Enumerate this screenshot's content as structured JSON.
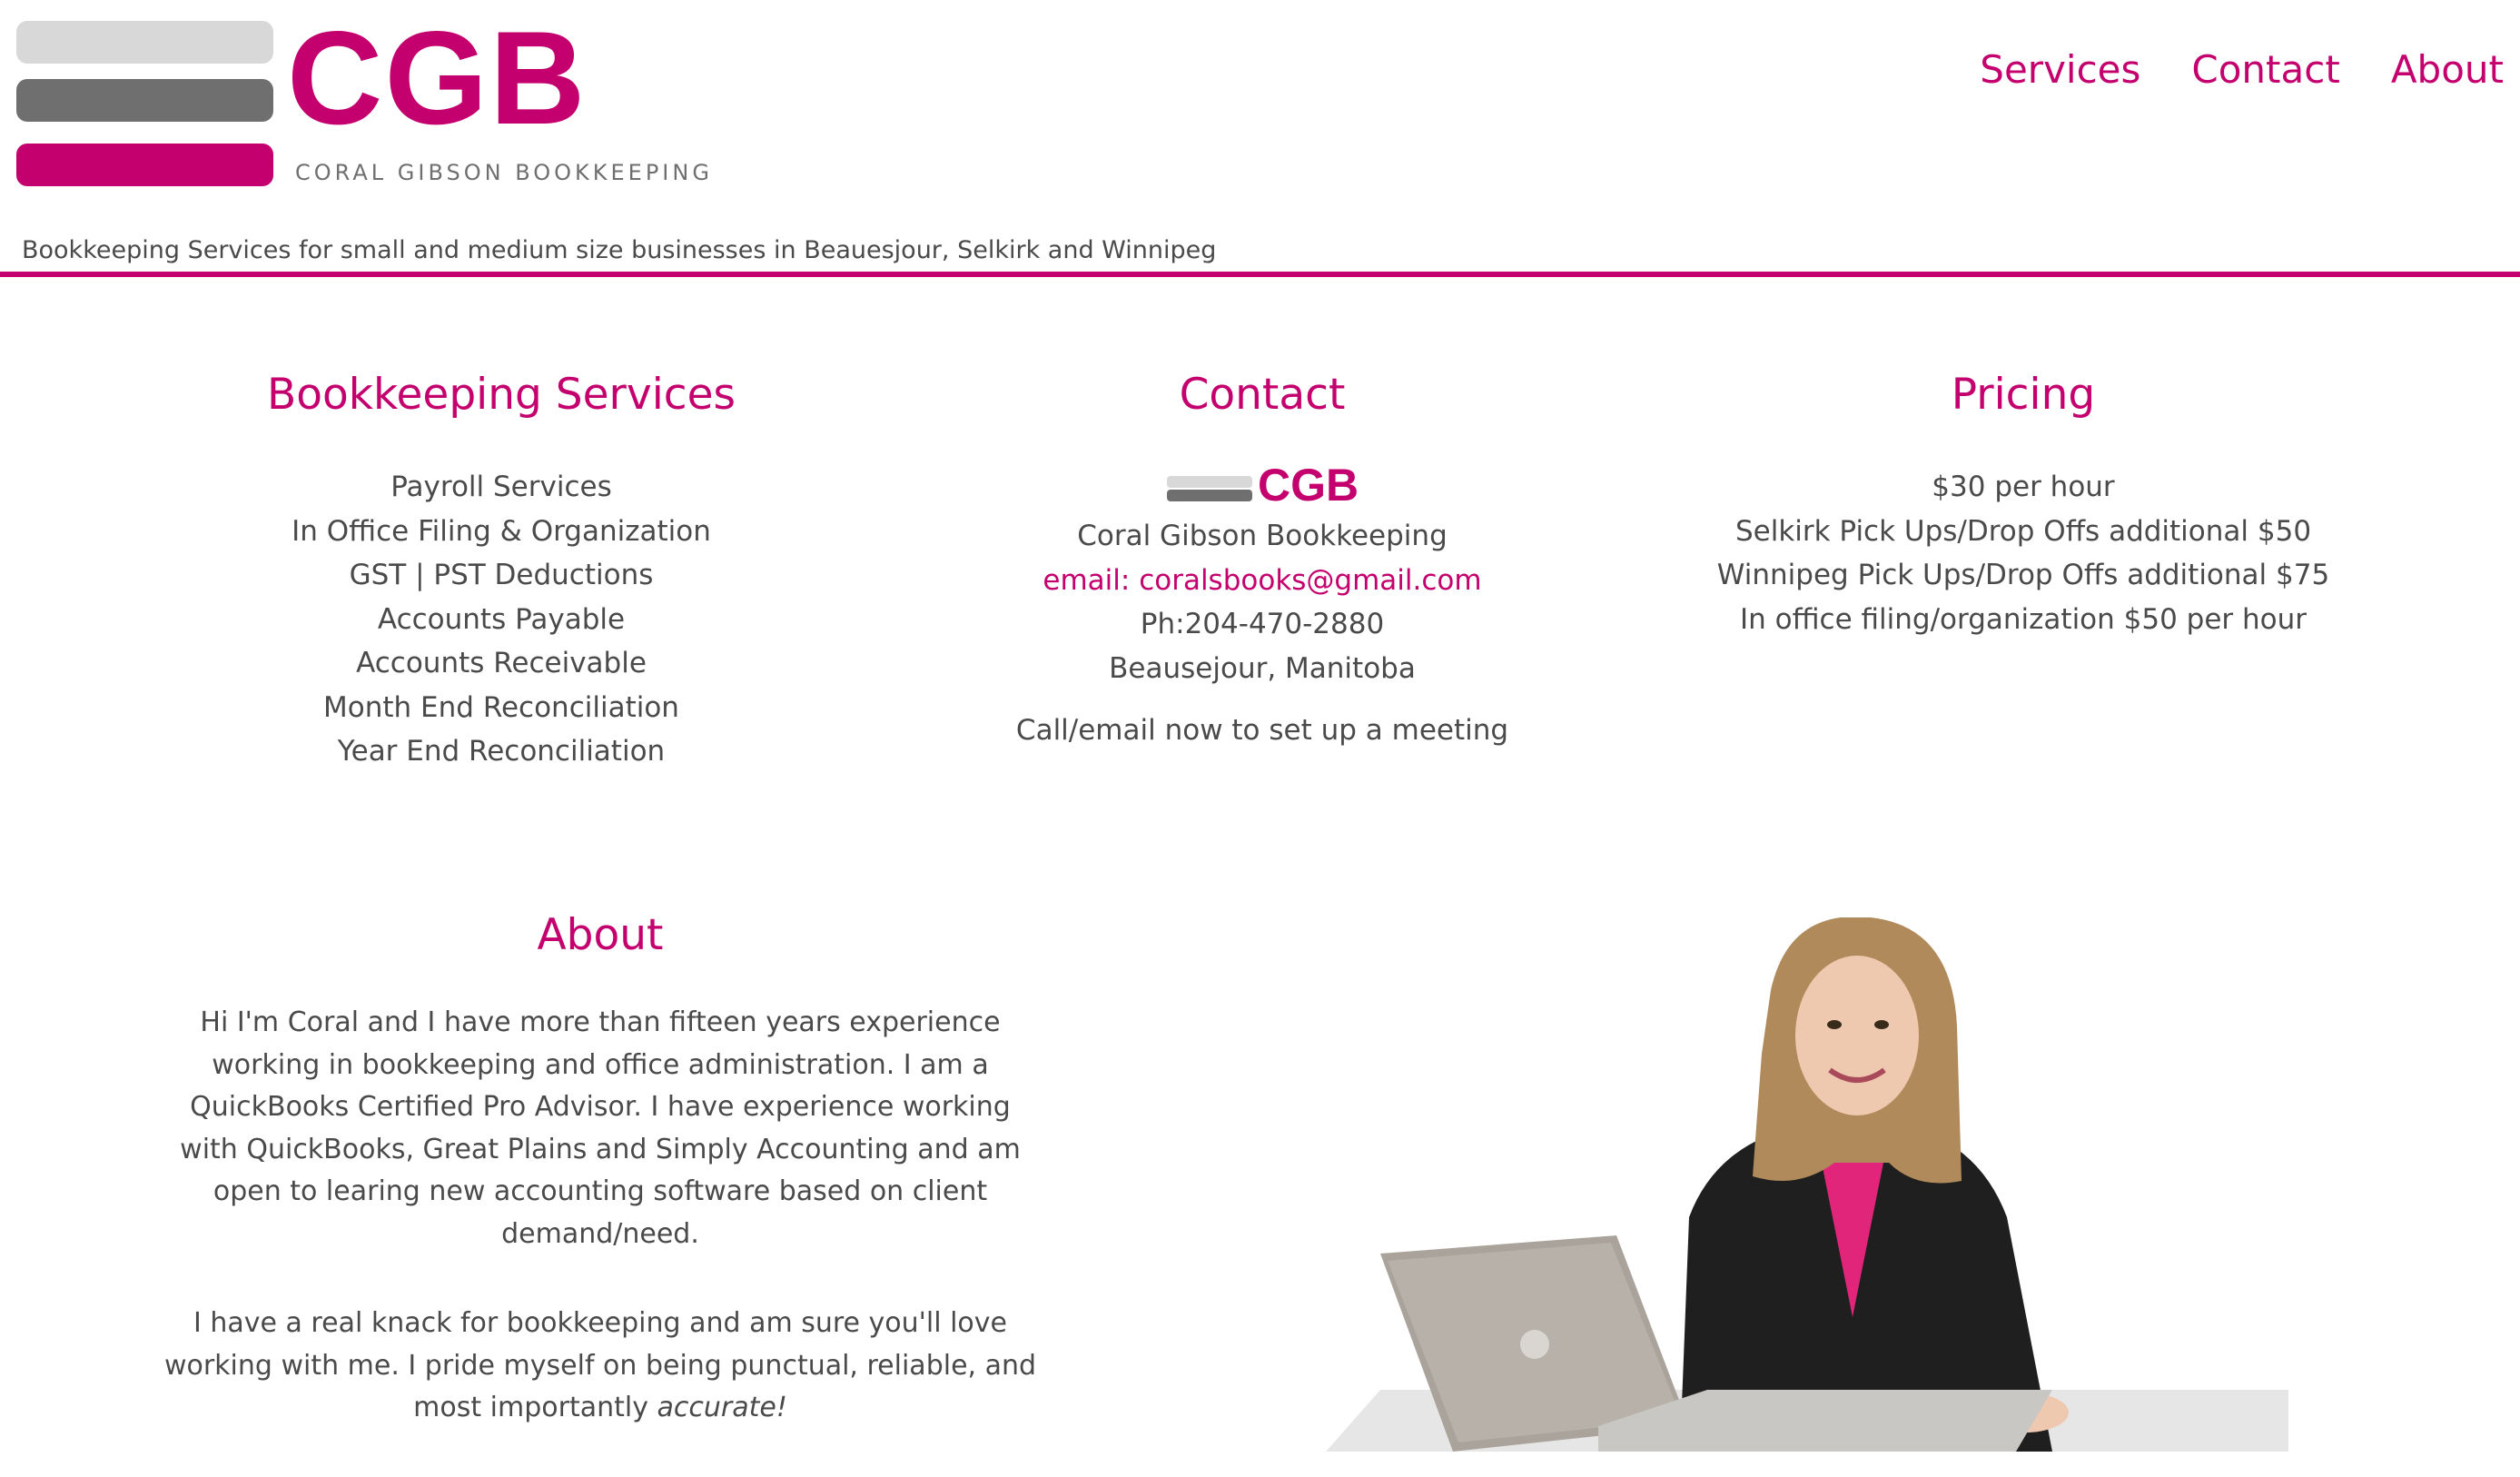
{
  "brand": {
    "logo_text": "CGB",
    "logo_subtitle": "CORAL GIBSON BOOKKEEPING",
    "tagline": "Bookkeeping Services for small and medium size businesses in Beauesjour, Selkirk and Winnipeg",
    "accent_color": "#c4006e"
  },
  "nav": {
    "items": [
      {
        "label": "Services"
      },
      {
        "label": "Contact"
      },
      {
        "label": "About"
      }
    ]
  },
  "services": {
    "title": "Bookkeeping Services",
    "items": [
      "Payroll Services",
      "In Office Filing & Organization",
      "GST | PST Deductions",
      "Accounts Payable",
      "Accounts Receivable",
      "Month End Reconciliation",
      "Year End Reconciliation"
    ]
  },
  "contact": {
    "title": "Contact",
    "logo_text": "CGB",
    "name": "Coral Gibson Bookkeeping",
    "email": "email: coralsbooks@gmail.com",
    "phone": "Ph:204-470-2880",
    "location": "Beausejour, Manitoba",
    "cta": "Call/email now to set up a meeting"
  },
  "pricing": {
    "title": "Pricing",
    "items": [
      "$30 per hour",
      "Selkirk Pick Ups/Drop Offs additional $50",
      "Winnipeg Pick Ups/Drop Offs additional $75",
      "In office filing/organization $50 per hour"
    ]
  },
  "about": {
    "title": "About",
    "paragraph1": "Hi I'm Coral and I have more than fifteen years experience working in bookkeeping and office administration. I am a QuickBooks Certified Pro Advisor. I have experience working with QuickBooks, Great Plains and Simply Accounting and am open to learing new accounting software based on client demand/need.",
    "paragraph2_main": "I have a real knack for bookkeeping and am sure you'll love working with me. I pride myself on being punctual, reliable, and most importantly ",
    "paragraph2_emphasis": "accurate!"
  }
}
